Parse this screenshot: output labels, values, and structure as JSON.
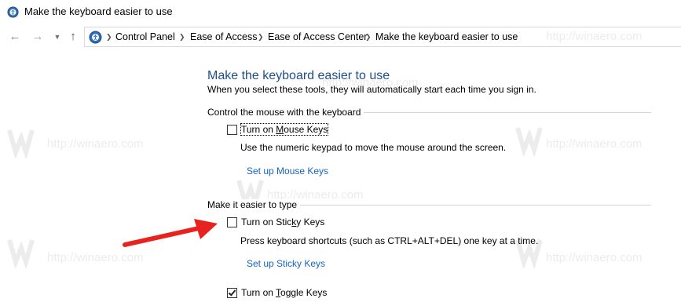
{
  "window": {
    "title": "Make the keyboard easier to use"
  },
  "nav": {
    "back_icon": "back-arrow-icon",
    "forward_icon": "forward-arrow-icon",
    "recent_icon": "chevron-down-icon",
    "up_icon": "up-arrow-icon",
    "breadcrumbs": [
      "Control Panel",
      "Ease of Access",
      "Ease of Access Center",
      "Make the keyboard easier to use"
    ]
  },
  "main": {
    "heading": "Make the keyboard easier to use",
    "subtitle": "When you select these tools, they will automatically start each time you sign in.",
    "mouse_section": {
      "title": "Control the mouse with the keyboard",
      "checkbox_pre": "Turn on ",
      "checkbox_underlined": "M",
      "checkbox_post": "ouse Keys",
      "checked": false,
      "description": "Use the numeric keypad to move the mouse around the screen.",
      "link": "Set up Mouse Keys"
    },
    "typing_section": {
      "title": "Make it easier to type",
      "sticky": {
        "pre": "Turn on Stic",
        "underlined": "k",
        "post": "y Keys",
        "checked": false,
        "description": "Press keyboard shortcuts (such as CTRL+ALT+DEL) one key at a time.",
        "link": "Set up Sticky Keys"
      },
      "toggle": {
        "pre": "Turn on ",
        "underlined": "T",
        "post": "oggle Keys",
        "checked": true
      }
    }
  },
  "watermark": {
    "text": "http://winaero.com"
  },
  "colors": {
    "heading": "#1e4e8c",
    "link": "#1565c0",
    "arrow": "#e8231f"
  }
}
